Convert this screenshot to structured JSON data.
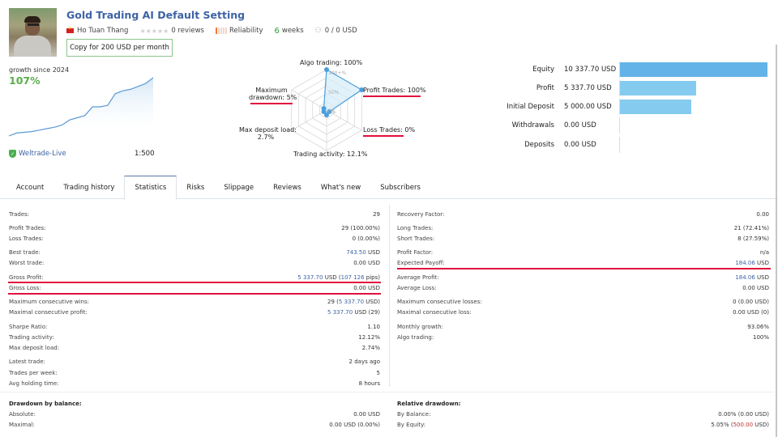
{
  "header": {
    "title": "Gold Trading AI Default Setting",
    "author": "Ho Tuan Thang",
    "reviews": "0 reviews",
    "reliability": "Reliability",
    "weeks_num": "6",
    "weeks_label": "weeks",
    "subscribers": "0 / 0 USD",
    "copy_button": "Copy for 200 USD per month"
  },
  "growth": {
    "label": "growth since 2024",
    "value": "107%",
    "broker": "Weltrade-Live",
    "leverage": "1:500",
    "series": [
      0,
      4,
      5,
      6,
      8,
      10,
      12,
      15,
      22,
      25,
      28,
      40,
      40,
      42,
      58,
      62,
      64,
      68,
      72,
      80
    ]
  },
  "radar": {
    "labels": {
      "algo": "Algo trading: 100%",
      "profit": "Profit Trades: 100%",
      "loss": "Loss Trades: 0%",
      "activity": "Trading activity: 12.1%",
      "deposit_load_1": "Max deposit load:",
      "deposit_load_2": "2.7%",
      "drawdown_1": "Maximum",
      "drawdown_2": "drawdown: 5%"
    },
    "scale": {
      "top": "100+%",
      "mid": "50%",
      "zero": "0%"
    },
    "values": {
      "algo": 100,
      "profit": 100,
      "loss": 0,
      "activity": 12.1,
      "deposit_load": 2.7,
      "drawdown": 5
    },
    "accent": "#4a9fdd"
  },
  "balance": {
    "rows": [
      {
        "label": "Equity",
        "value": "10 337.70 USD",
        "amount": 10337.7,
        "color": "#63b3e8"
      },
      {
        "label": "Profit",
        "value": "5 337.70 USD",
        "amount": 5337.7,
        "color": "#85cbf0"
      },
      {
        "label": "Initial Deposit",
        "value": "5 000.00 USD",
        "amount": 5000.0,
        "color": "#85cbf0"
      },
      {
        "label": "Withdrawals",
        "value": "0.00 USD",
        "amount": 0,
        "color": "#85cbf0"
      },
      {
        "label": "Deposits",
        "value": "0.00 USD",
        "amount": 0,
        "color": "#85cbf0"
      }
    ]
  },
  "tabs": [
    "Account",
    "Trading history",
    "Statistics",
    "Risks",
    "Slippage",
    "Reviews",
    "What's new",
    "Subscribers"
  ],
  "active_tab": "Statistics",
  "stats_left": {
    "trades": {
      "label": "Trades:",
      "value": "29"
    },
    "profit_trades": {
      "label": "Profit Trades:",
      "value": "29 (100.00%)"
    },
    "loss_trades": {
      "label": "Loss Trades:",
      "value": "0 (0.00%)"
    },
    "best_trade": {
      "label": "Best trade:",
      "value_link": "743.50",
      "value_suffix": " USD"
    },
    "worst_trade": {
      "label": "Worst trade:",
      "value": "0.00 USD"
    },
    "gross_profit": {
      "label": "Gross Profit:",
      "value_link": "5 337.70",
      "value_mid": " USD (",
      "value_link2": "107 126",
      "value_suffix": " pips)"
    },
    "gross_loss": {
      "label": "Gross Loss:",
      "value": "0.00 USD"
    },
    "max_cons_wins": {
      "label": "Maximum consecutive wins:",
      "value_prefix": "29 (",
      "value_link": "5 337.70",
      "value_suffix": " USD)"
    },
    "max_cons_profit": {
      "label": "Maximal consecutive profit:",
      "value_link": "5 337.70",
      "value_suffix": " USD (29)"
    },
    "sharpe": {
      "label": "Sharpe Ratio:",
      "value": "1.10"
    },
    "activity": {
      "label": "Trading activity:",
      "value": "12.12%"
    },
    "deposit_load": {
      "label": "Max deposit load:",
      "value": "2.74%"
    },
    "latest_trade": {
      "label": "Latest trade:",
      "value": "2 days ago"
    },
    "trades_per_week": {
      "label": "Trades per week:",
      "value": "5"
    },
    "avg_holding": {
      "label": "Avg holding time:",
      "value": "8 hours"
    }
  },
  "stats_right": {
    "recovery": {
      "label": "Recovery Factor:",
      "value": "0.00"
    },
    "long": {
      "label": "Long Trades:",
      "value": "21 (72.41%)"
    },
    "short": {
      "label": "Short Trades:",
      "value": "8 (27.59%)"
    },
    "profit_factor": {
      "label": "Profit Factor:",
      "value": "n/a"
    },
    "expected_payoff": {
      "label": "Expected Payoff:",
      "value_link": "184.06",
      "value_suffix": " USD"
    },
    "avg_profit": {
      "label": "Average Profit:",
      "value_link": "184.06",
      "value_suffix": " USD"
    },
    "avg_loss": {
      "label": "Average Loss:",
      "value": "0.00 USD"
    },
    "max_cons_losses": {
      "label": "Maximum consecutive losses:",
      "value": "0 (0.00 USD)"
    },
    "max_cons_loss": {
      "label": "Maximal consecutive loss:",
      "value": "0.00 USD (0)"
    },
    "monthly_growth": {
      "label": "Monthly growth:",
      "value_link": "93.06%"
    },
    "algo": {
      "label": "Algo trading:",
      "value": "100%"
    }
  },
  "drawdown_balance": {
    "heading": "Drawdown by balance:",
    "absolute": {
      "label": "Absolute:",
      "value": "0.00 USD"
    },
    "maximal": {
      "label": "Maximal:",
      "value": "0.00 USD (0.00%)"
    }
  },
  "relative_drawdown": {
    "heading": "Relative drawdown:",
    "by_balance": {
      "label": "By Balance:",
      "value": "0.00% (0.00 USD)"
    },
    "by_equity": {
      "label": "By Equity:",
      "value_prefix": "5.05% (",
      "value_neg": "500.00",
      "value_suffix": " USD)"
    }
  },
  "highlight_color": "#e0103c"
}
